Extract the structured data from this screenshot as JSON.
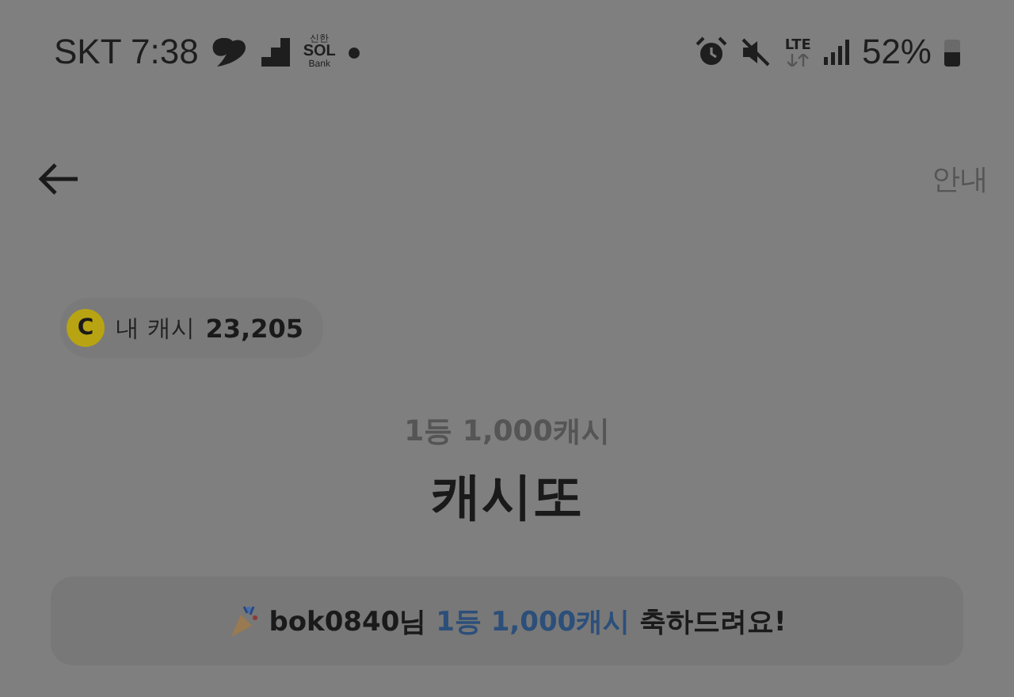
{
  "status_bar": {
    "carrier_time": "SKT 7:38",
    "notification_logo": {
      "top": "신한",
      "middle": "SOL",
      "bottom": "Bank"
    },
    "network": "LTE",
    "battery": "52%"
  },
  "header": {
    "info_link": "안내"
  },
  "cash_chip": {
    "coin": "C",
    "label": "내 캐시",
    "amount": "23,205"
  },
  "prize": "1등 1,000캐시",
  "title": "캐시또",
  "banner": {
    "segments": [
      {
        "text": "bok0840님 ",
        "highlight": false
      },
      {
        "text": "1등 1,000캐시",
        "highlight": true
      },
      {
        "text": " 축하드려요!",
        "highlight": false
      }
    ]
  }
}
